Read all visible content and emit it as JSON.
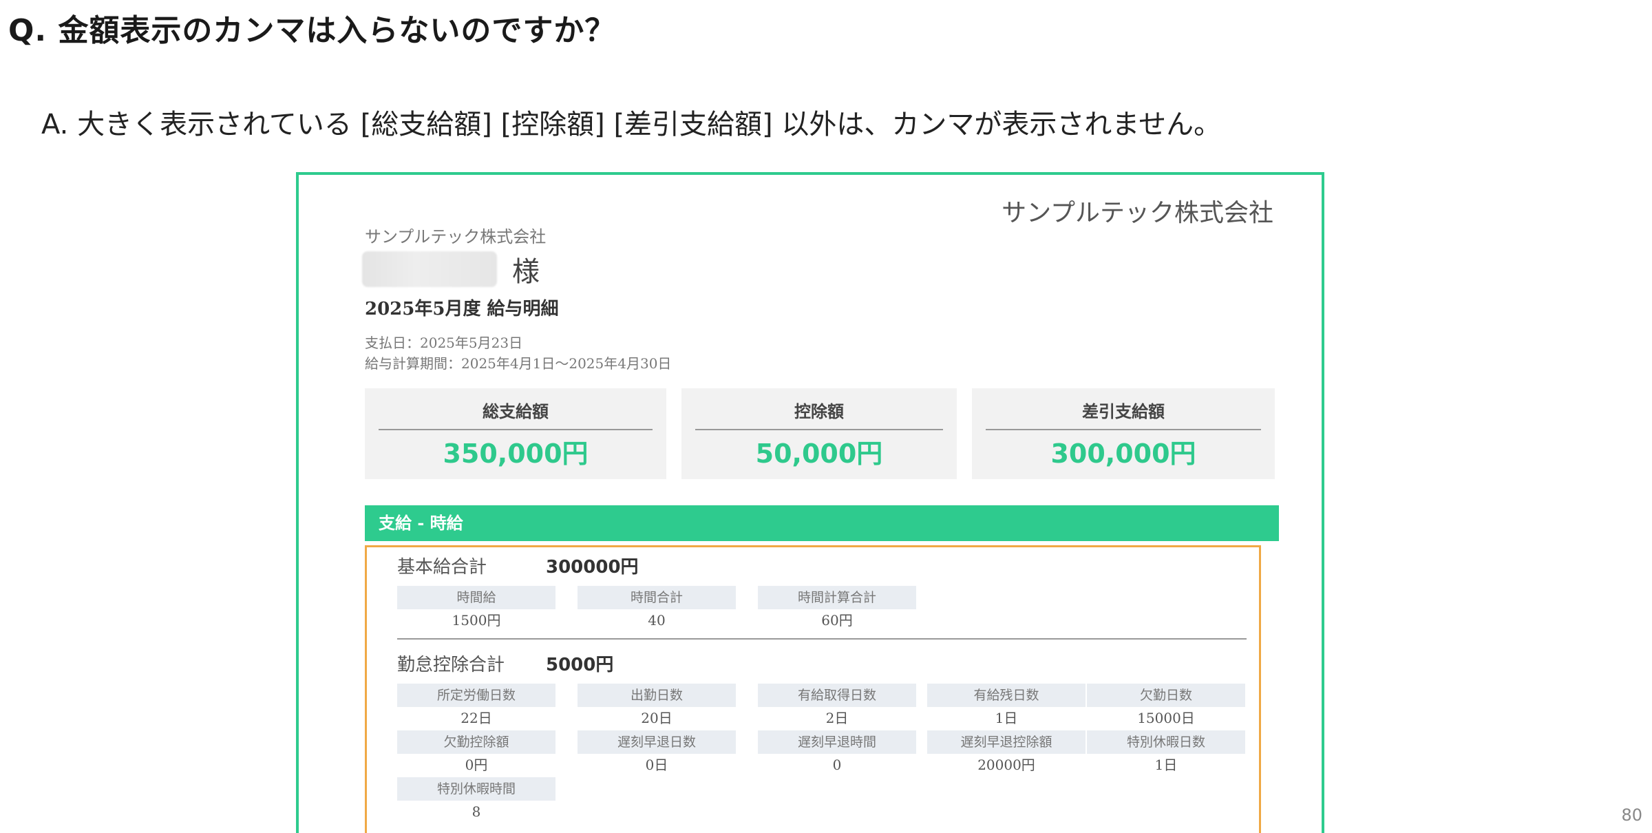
{
  "question": "Q.  金額表示のカンマは入らないのですか？",
  "answer": "A.  大きく表示されている [総支給額] [控除額] [差引支給額] 以外は、カンマが表示されません。",
  "page_number": "80",
  "payslip": {
    "company_name": "サンプルテック株式会社",
    "company_name_small": "サンプルテック株式会社",
    "honorific": "様",
    "title": "2025年5月度 給与明細",
    "pay_date": "支払日：2025年5月23日",
    "pay_period": "給与計算期間：2025年4月1日～2025年4月30日",
    "summary": [
      {
        "label": "総支給額",
        "amount": "350,000円"
      },
      {
        "label": "控除額",
        "amount": "50,000円"
      },
      {
        "label": "差引支給額",
        "amount": "300,000円"
      }
    ],
    "section_title": "支給 - 時給",
    "basic": {
      "label": "基本給合計",
      "value": "300000円",
      "cells": [
        {
          "head": "時間給",
          "value": "1500円"
        },
        {
          "head": "時間合計",
          "value": "40"
        },
        {
          "head": "時間計算合計",
          "value": "60円"
        }
      ]
    },
    "attendance": {
      "label": "勤怠控除合計",
      "value": "5000円",
      "cells": [
        {
          "head": "所定労働日数",
          "value": "22日"
        },
        {
          "head": "出勤日数",
          "value": "20日"
        },
        {
          "head": "有給取得日数",
          "value": "2日"
        },
        {
          "head": "有給残日数",
          "value": "1日"
        },
        {
          "head": "欠勤日数",
          "value": "15000日"
        },
        {
          "head": "欠勤控除額",
          "value": "0円"
        },
        {
          "head": "遅刻早退日数",
          "value": "0日"
        },
        {
          "head": "遅刻早退時間",
          "value": "0"
        },
        {
          "head": "遅刻早退控除額",
          "value": "20000円"
        },
        {
          "head": "特別休暇日数",
          "value": "1日"
        },
        {
          "head": "特別休暇時間",
          "value": "8"
        }
      ]
    }
  },
  "colors": {
    "accent_green": "#2ecb8e",
    "amount_green": "#2ec98c",
    "detail_border_orange": "#f0a945"
  }
}
